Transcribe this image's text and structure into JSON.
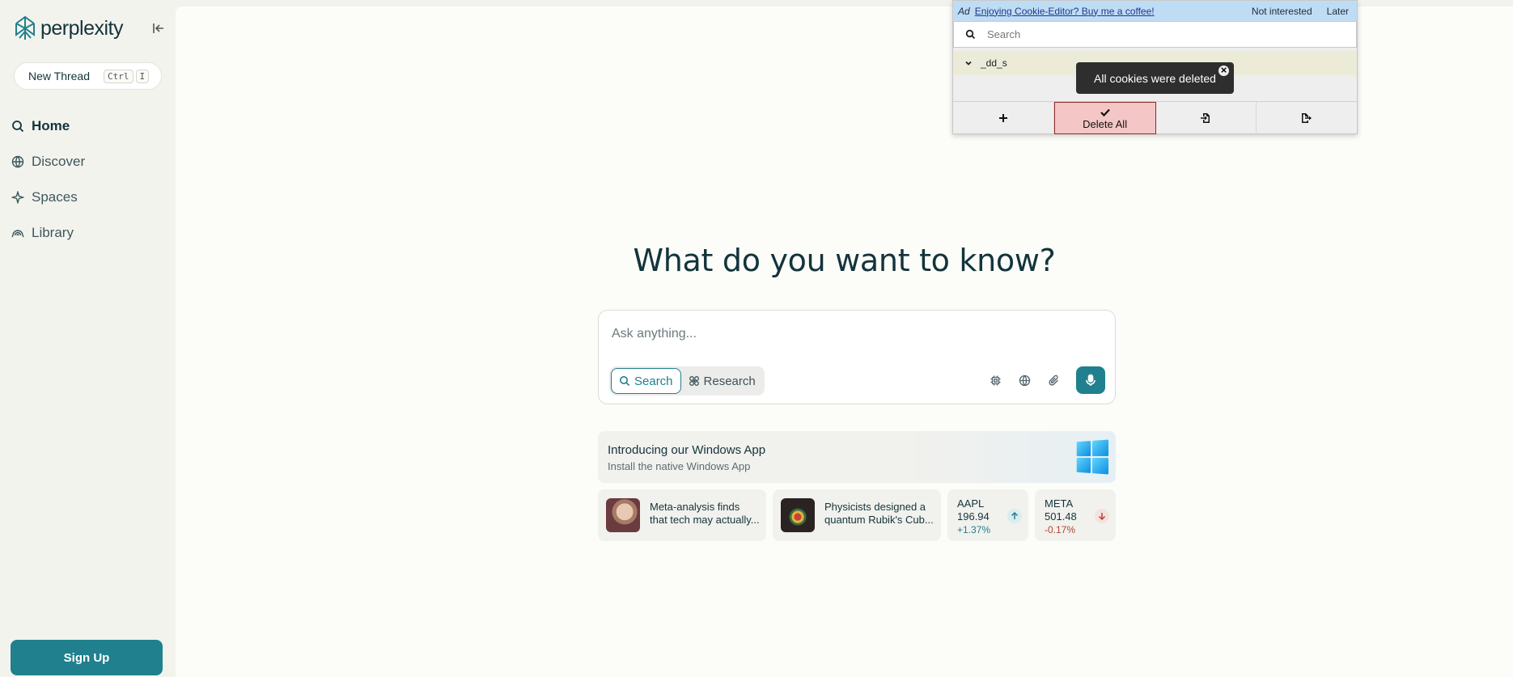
{
  "sidebar": {
    "brand": "perplexity",
    "new_thread": {
      "label": "New Thread",
      "keys": [
        "Ctrl",
        "I"
      ]
    },
    "nav": [
      {
        "label": "Home",
        "icon": "search-icon",
        "active": true
      },
      {
        "label": "Discover",
        "icon": "globe-icon",
        "active": false
      },
      {
        "label": "Spaces",
        "icon": "spaces-icon",
        "active": false
      },
      {
        "label": "Library",
        "icon": "library-icon",
        "active": false
      }
    ],
    "signup_label": "Sign Up"
  },
  "main": {
    "headline": "What do you want to know?",
    "search": {
      "placeholder": "Ask anything...",
      "modes": [
        {
          "label": "Search",
          "active": true
        },
        {
          "label": "Research",
          "active": false
        }
      ]
    },
    "promo": {
      "title": "Introducing our Windows App",
      "subtitle": "Install the native Windows App"
    },
    "news": [
      {
        "line1": "Meta-analysis finds",
        "line2": "that tech may actually..."
      },
      {
        "line1": "Physicists designed a",
        "line2": "quantum Rubik's Cub..."
      }
    ],
    "stocks": [
      {
        "symbol": "AAPL",
        "price": "196.94",
        "change": "+1.37%",
        "direction": "up"
      },
      {
        "symbol": "META",
        "price": "501.48",
        "change": "-0.17%",
        "direction": "down"
      }
    ]
  },
  "cookie_editor": {
    "ad_tag": "Ad",
    "ad_text": "Enjoying Cookie-Editor? Buy me a coffee!",
    "not_interested": "Not interested",
    "later": "Later",
    "search_placeholder": "Search",
    "cookie_name": "_dd_s",
    "toast": "All cookies were deleted",
    "delete_all": "Delete All"
  },
  "colors": {
    "accent": "#20808d",
    "text": "#13343b",
    "stock_up": "#20808d",
    "stock_down": "#b24531"
  }
}
